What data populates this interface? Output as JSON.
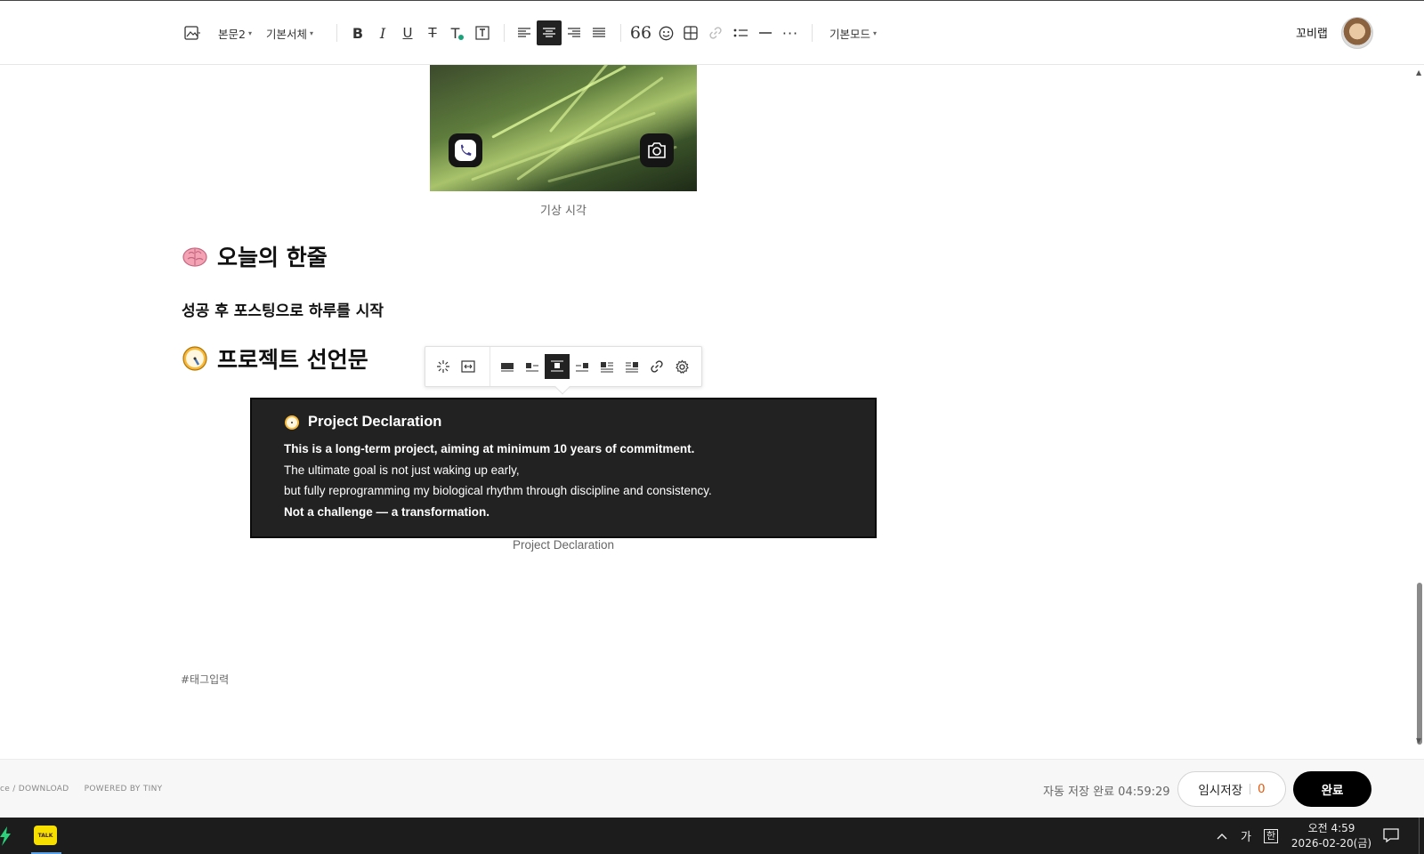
{
  "toolbar": {
    "style_select": "본문2",
    "font_select": "기본서체",
    "mode_select": "기본모드",
    "user_name": "꼬비랩"
  },
  "content": {
    "image_caption": "기상 시각",
    "heading1": "오늘의 한줄",
    "bold_line": "성공 후 포스팅으로 하루를 시작",
    "heading2": "프로젝트 선언문",
    "declaration": {
      "title": "Project Declaration",
      "line1": "This is a long-term project, aiming at minimum 10 years of commitment.",
      "line2": "The ultimate goal is not just waking up early,",
      "line3": "but fully reprogramming my biological rhythm through discipline and consistency.",
      "line4": "Not a challenge — a transformation."
    },
    "declaration_caption": "Project Declaration",
    "tag_placeholder": "#태그입력"
  },
  "footer": {
    "link1": "ce / DOWNLOAD",
    "link2": "POWERED BY TINY",
    "autosave_label": "자동 저장 완료",
    "autosave_time": "04:59:29",
    "draft_label": "임시저장",
    "draft_count": "0",
    "done_label": "완료"
  },
  "taskbar": {
    "kakao_label": "TALK",
    "ime_lang": "가",
    "ime_mode": "한",
    "time": "오전 4:59",
    "date": "2026-02-20(금)"
  },
  "colors": {
    "accent_dark": "#222222",
    "draft_count": "#e8590c",
    "kakao": "#f7e000"
  }
}
